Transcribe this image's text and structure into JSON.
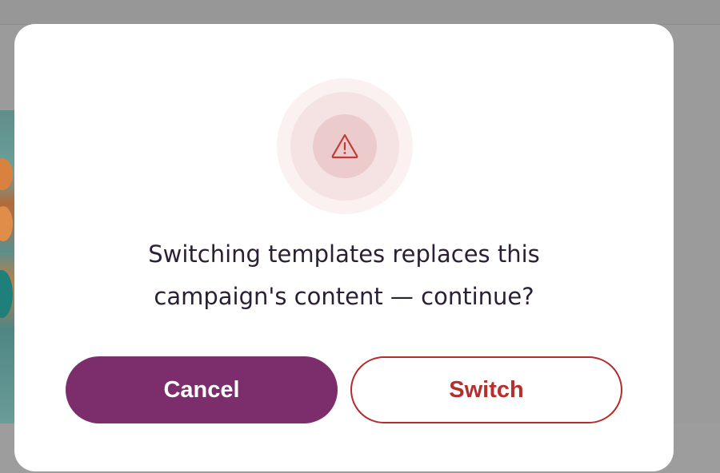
{
  "dialog": {
    "icon": "warning-triangle-icon",
    "message_line1": "Switching templates replaces this",
    "message_line2": "campaign's content — continue?",
    "cancel_label": "Cancel",
    "confirm_label": "Switch"
  },
  "colors": {
    "primary": "#7b2e6b",
    "danger": "#b3302d",
    "text": "#2a1f33",
    "overlay": "#9b9b9b"
  }
}
